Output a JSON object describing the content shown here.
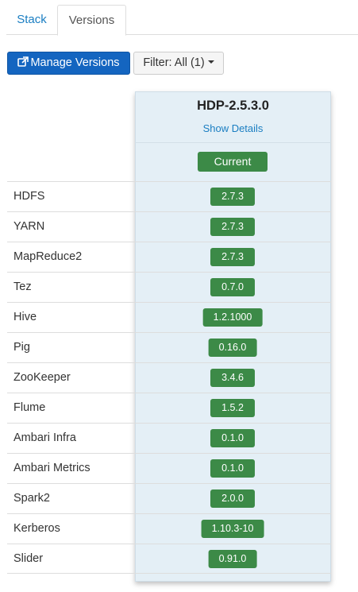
{
  "tabs": [
    {
      "label": "Stack",
      "active": false
    },
    {
      "label": "Versions",
      "active": true
    }
  ],
  "toolbar": {
    "manage_label": "Manage Versions",
    "manage_icon": "external-link-icon",
    "filter_label": "Filter: All (1)"
  },
  "version": {
    "name": "HDP-2.5.3.0",
    "details_link": "Show Details",
    "status_label": "Current"
  },
  "services": [
    {
      "name": "HDFS",
      "version": "2.7.3"
    },
    {
      "name": "YARN",
      "version": "2.7.3"
    },
    {
      "name": "MapReduce2",
      "version": "2.7.3"
    },
    {
      "name": "Tez",
      "version": "0.7.0"
    },
    {
      "name": "Hive",
      "version": "1.2.1000"
    },
    {
      "name": "Pig",
      "version": "0.16.0"
    },
    {
      "name": "ZooKeeper",
      "version": "3.4.6"
    },
    {
      "name": "Flume",
      "version": "1.5.2"
    },
    {
      "name": "Ambari Infra",
      "version": "0.1.0"
    },
    {
      "name": "Ambari Metrics",
      "version": "0.1.0"
    },
    {
      "name": "Spark2",
      "version": "2.0.0"
    },
    {
      "name": "Kerberos",
      "version": "1.10.3-10"
    },
    {
      "name": "Slider",
      "version": "0.91.0"
    }
  ],
  "colors": {
    "primary": "#1465c0",
    "link": "#1a7ec2",
    "badge_green": "#3c8a47",
    "column_bg": "#e4eff6"
  }
}
